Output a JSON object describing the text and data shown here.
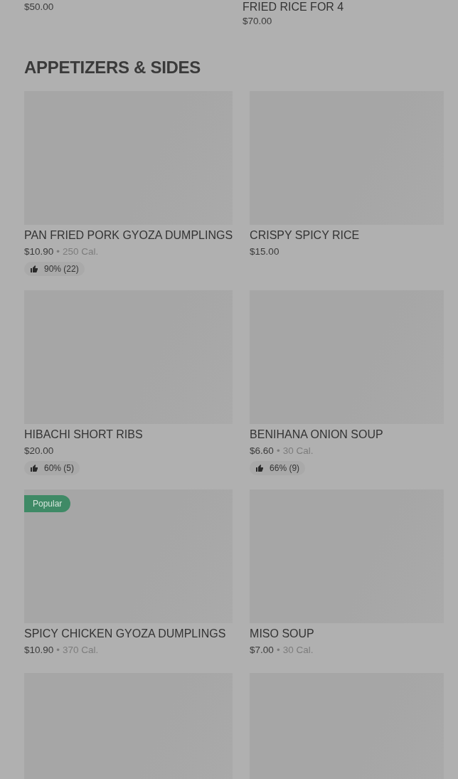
{
  "previous_section": {
    "items": [
      {
        "price": "$50.00"
      },
      {
        "name": "FRIED RICE FOR 4",
        "price": "$70.00"
      }
    ]
  },
  "section": {
    "title": "APPETIZERS & SIDES",
    "items": [
      {
        "kind": "dish",
        "name": "PAN FRIED PORK GYOZA DUMPLINGS",
        "price": "$10.90",
        "separator": "•",
        "calories": "250 Cal.",
        "rating": "90% (22)"
      },
      {
        "kind": "dish",
        "name": "CRISPY SPICY RICE",
        "price": "$15.00"
      },
      {
        "kind": "dish",
        "name": "HIBACHI SHORT RIBS",
        "price": "$20.00",
        "rating": "60% (5)"
      },
      {
        "kind": "dish",
        "name": "BENIHANA ONION SOUP",
        "price": "$6.60",
        "separator": "•",
        "calories": "30 Cal.",
        "rating": "66% (9)"
      },
      {
        "kind": "dish",
        "tag": "Popular",
        "name": "SPICY CHICKEN GYOZA DUMPLINGS",
        "price": "$10.90",
        "separator": "•",
        "calories": "370 Cal."
      },
      {
        "kind": "dish",
        "name": "MISO SOUP",
        "price": "$7.00",
        "separator": "•",
        "calories": "30 Cal."
      },
      {
        "kind": "placeholder"
      },
      {
        "kind": "placeholder"
      }
    ]
  }
}
